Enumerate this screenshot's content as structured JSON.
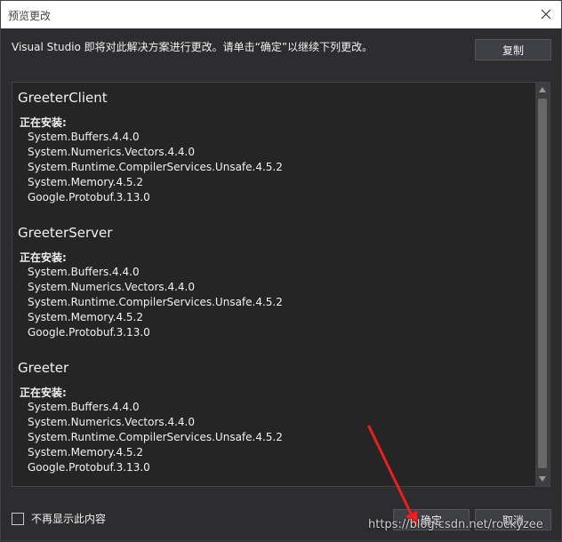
{
  "window": {
    "title": "预览更改"
  },
  "intro_text": "Visual Studio 即将对此解决方案进行更改。请单击“确定”以继续下列更改。",
  "copy_button": "复制",
  "projects": [
    {
      "name": "GreeterClient",
      "section_label": "正在安装:",
      "packages": [
        "System.Buffers.4.4.0",
        "System.Numerics.Vectors.4.4.0",
        "System.Runtime.CompilerServices.Unsafe.4.5.2",
        "System.Memory.4.5.2",
        "Google.Protobuf.3.13.0"
      ]
    },
    {
      "name": "GreeterServer",
      "section_label": "正在安装:",
      "packages": [
        "System.Buffers.4.4.0",
        "System.Numerics.Vectors.4.4.0",
        "System.Runtime.CompilerServices.Unsafe.4.5.2",
        "System.Memory.4.5.2",
        "Google.Protobuf.3.13.0"
      ]
    },
    {
      "name": "Greeter",
      "section_label": "正在安装:",
      "packages": [
        "System.Buffers.4.4.0",
        "System.Numerics.Vectors.4.4.0",
        "System.Runtime.CompilerServices.Unsafe.4.5.2",
        "System.Memory.4.5.2",
        "Google.Protobuf.3.13.0"
      ]
    }
  ],
  "footer": {
    "checkbox_label": "不再显示此内容",
    "ok_button": "确定",
    "cancel_button": "取消"
  },
  "watermark": "https://blog.csdn.net/rockyzee",
  "colors": {
    "background": "#2d2d30",
    "panel": "#252526",
    "annotation_arrow": "#e8201f"
  }
}
